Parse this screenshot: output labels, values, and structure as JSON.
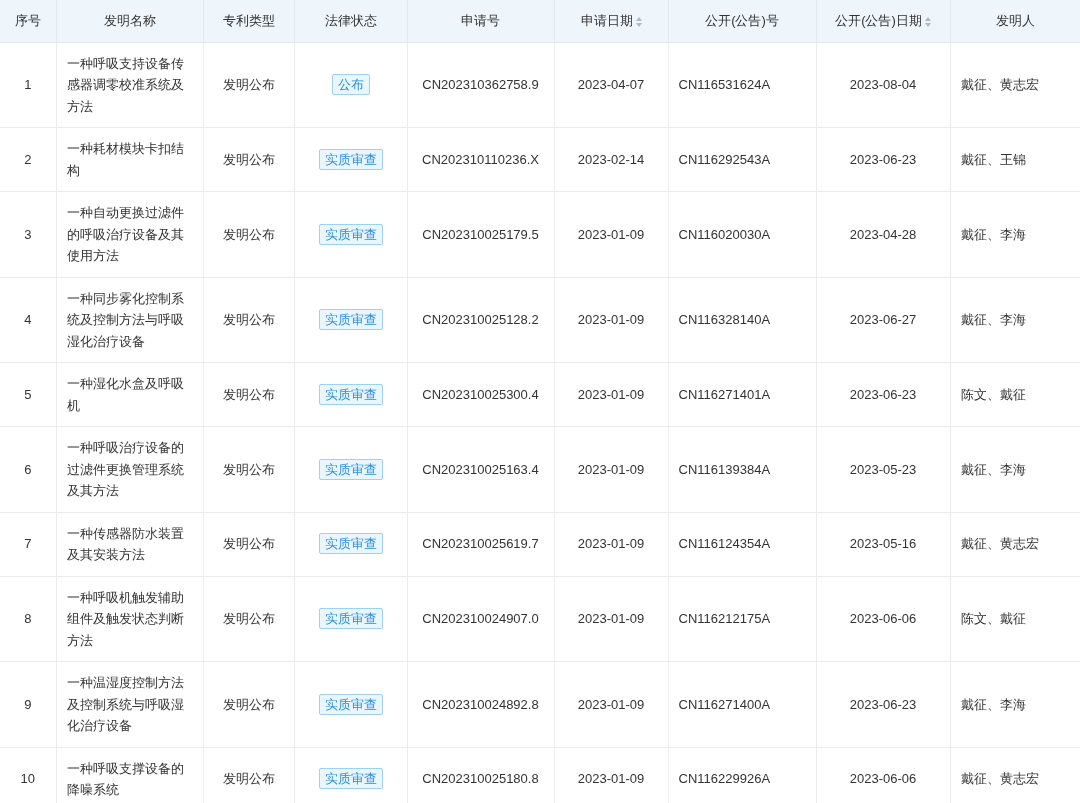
{
  "table": {
    "columns": [
      {
        "label": "序号",
        "sortable": false
      },
      {
        "label": "发明名称",
        "sortable": false
      },
      {
        "label": "专利类型",
        "sortable": false
      },
      {
        "label": "法律状态",
        "sortable": false
      },
      {
        "label": "申请号",
        "sortable": false
      },
      {
        "label": "申请日期",
        "sortable": true
      },
      {
        "label": "公开(公告)号",
        "sortable": false
      },
      {
        "label": "公开(公告)日期",
        "sortable": true
      },
      {
        "label": "发明人",
        "sortable": false
      }
    ],
    "rows": [
      [
        "1",
        "一种呼吸支持设备传感器调零校准系统及方法",
        "发明公布",
        "公布",
        "CN202310362758.9",
        "2023-04-07",
        "CN116531624A",
        "2023-08-04",
        "戴征、黄志宏"
      ],
      [
        "2",
        "一种耗材模块卡扣结构",
        "发明公布",
        "实质审查",
        "CN202310110236.X",
        "2023-02-14",
        "CN116292543A",
        "2023-06-23",
        "戴征、王锦"
      ],
      [
        "3",
        "一种自动更换过滤件的呼吸治疗设备及其使用方法",
        "发明公布",
        "实质审查",
        "CN202310025179.5",
        "2023-01-09",
        "CN116020030A",
        "2023-04-28",
        "戴征、李海"
      ],
      [
        "4",
        "一种同步雾化控制系统及控制方法与呼吸湿化治疗设备",
        "发明公布",
        "实质审查",
        "CN202310025128.2",
        "2023-01-09",
        "CN116328140A",
        "2023-06-27",
        "戴征、李海"
      ],
      [
        "5",
        "一种湿化水盒及呼吸机",
        "发明公布",
        "实质审查",
        "CN202310025300.4",
        "2023-01-09",
        "CN116271401A",
        "2023-06-23",
        "陈文、戴征"
      ],
      [
        "6",
        "一种呼吸治疗设备的过滤件更换管理系统及其方法",
        "发明公布",
        "实质审查",
        "CN202310025163.4",
        "2023-01-09",
        "CN116139384A",
        "2023-05-23",
        "戴征、李海"
      ],
      [
        "7",
        "一种传感器防水装置及其安装方法",
        "发明公布",
        "实质审查",
        "CN202310025619.7",
        "2023-01-09",
        "CN116124354A",
        "2023-05-16",
        "戴征、黄志宏"
      ],
      [
        "8",
        "一种呼吸机触发辅助组件及触发状态判断方法",
        "发明公布",
        "实质审查",
        "CN202310024907.0",
        "2023-01-09",
        "CN116212175A",
        "2023-06-06",
        "陈文、戴征"
      ],
      [
        "9",
        "一种温湿度控制方法及控制系统与呼吸湿化治疗设备",
        "发明公布",
        "实质审查",
        "CN202310024892.8",
        "2023-01-09",
        "CN116271400A",
        "2023-06-23",
        "戴征、李海"
      ],
      [
        "10",
        "一种呼吸支撑设备的降噪系统",
        "发明公布",
        "实质审查",
        "CN202310025180.8",
        "2023-01-09",
        "CN116229926A",
        "2023-06-06",
        "戴征、黄志宏"
      ]
    ]
  }
}
